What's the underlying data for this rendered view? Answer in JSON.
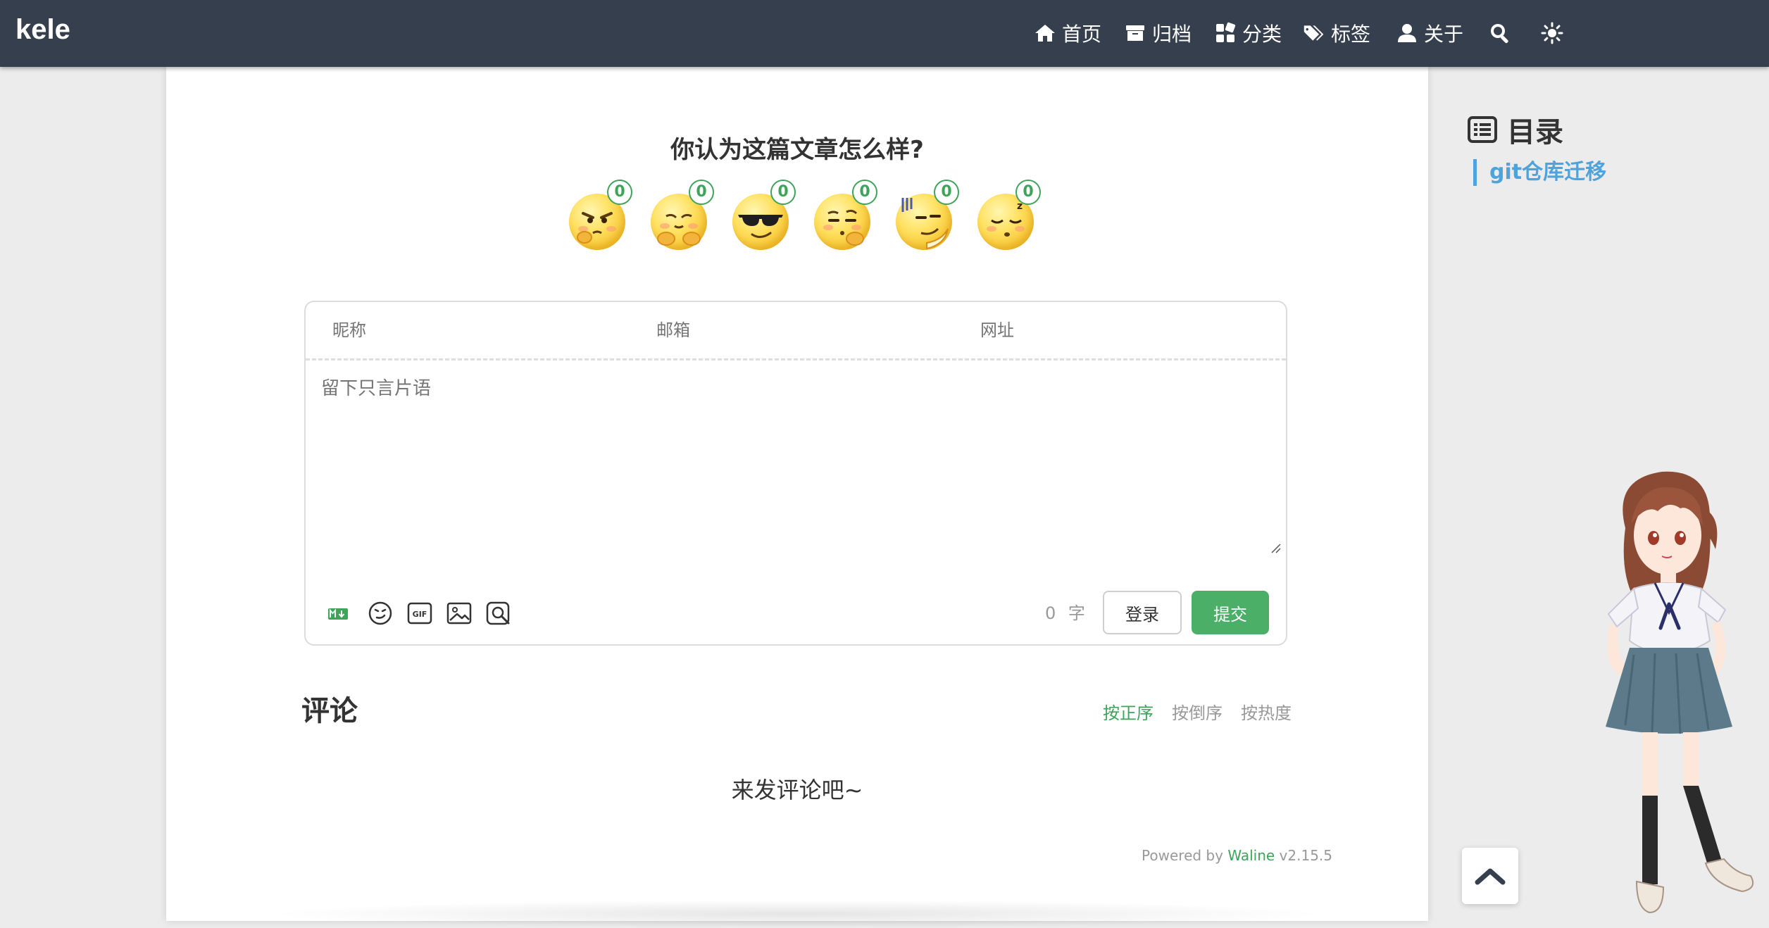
{
  "brand": "kele",
  "nav": {
    "items": [
      {
        "icon": "home-icon",
        "label": "首页"
      },
      {
        "icon": "archive-icon",
        "label": "归档"
      },
      {
        "icon": "categories-icon",
        "label": "分类"
      },
      {
        "icon": "tags-icon",
        "label": "标签"
      },
      {
        "icon": "user-icon",
        "label": "关于"
      }
    ],
    "search_icon": "search-icon",
    "theme_icon": "sun-icon"
  },
  "reaction": {
    "title": "你认为这篇文章怎么样?",
    "items": [
      {
        "name": "angry-thinking",
        "count": "0"
      },
      {
        "name": "hugging",
        "count": "0"
      },
      {
        "name": "sunglasses",
        "count": "0"
      },
      {
        "name": "thinking",
        "count": "0"
      },
      {
        "name": "smug-sweat",
        "count": "0"
      },
      {
        "name": "sleeping",
        "count": "0"
      }
    ]
  },
  "editor": {
    "nick_label": "昵称",
    "mail_label": "邮箱",
    "link_label": "网址",
    "placeholder": "留下只言片语",
    "word_count": "0",
    "word_unit": "字",
    "login_label": "登录",
    "submit_label": "提交",
    "tools": [
      "markdown-icon",
      "emoji-icon",
      "gif-icon",
      "image-icon",
      "preview-icon"
    ]
  },
  "comments": {
    "title": "评论",
    "sort": [
      "按正序",
      "按倒序",
      "按热度"
    ],
    "active_sort": 0,
    "empty": "来发评论吧~",
    "powered_prefix": "Powered by",
    "powered_link": "Waline",
    "version": "v2.15.5"
  },
  "toc": {
    "title": "目录",
    "items": [
      "git仓库迁移"
    ]
  },
  "colors": {
    "navbar": "#363f4d",
    "accent_green": "#4caf68",
    "toc_blue": "#4ea3dc",
    "page_bg": "#ececec"
  }
}
